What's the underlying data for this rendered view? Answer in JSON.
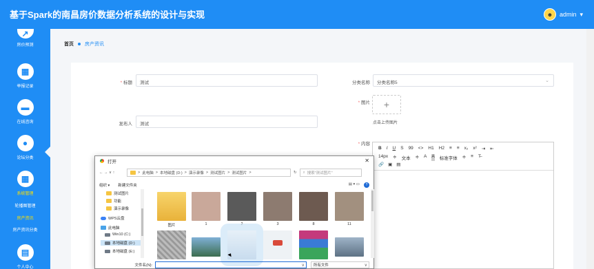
{
  "app": {
    "title": "基于Spark的南昌房价数据分析系统的设计与实现"
  },
  "user": {
    "name": "admin",
    "caret": "▾",
    "avatar_glyph": "☻"
  },
  "sidebar": {
    "items": [
      {
        "label": "房价预测",
        "icon": "trend-icon",
        "glyph": "↗"
      },
      {
        "label": "举报记录",
        "icon": "grid-icon",
        "glyph": "▦"
      },
      {
        "label": "在线咨询",
        "icon": "briefcase-icon",
        "glyph": "▬"
      },
      {
        "label": "论坛分类",
        "icon": "bulb-icon",
        "glyph": "●"
      },
      {
        "label": "系统管理",
        "icon": "apps-icon",
        "glyph": "▦"
      },
      {
        "label": "个人中心",
        "icon": "card-icon",
        "glyph": "▤"
      }
    ],
    "subitems": [
      {
        "label": "轮播图管理",
        "active": false
      },
      {
        "label": "房产资讯",
        "active": true
      },
      {
        "label": "房产资讯分类",
        "active": false
      }
    ]
  },
  "breadcrumb": {
    "home": "首页",
    "current": "房产资讯"
  },
  "form": {
    "title_label": "标题",
    "title_value": "测试",
    "category_label": "分类名称",
    "category_value": "分类名称5",
    "image_label": "图片",
    "upload_hint": "点击上传图片",
    "upload_plus": "+",
    "publisher_label": "发布人",
    "publisher_value": "测试",
    "content_label": "内容",
    "required_mark": "*"
  },
  "editor": {
    "toolbar_row1": [
      "B",
      "I",
      "U",
      "S",
      "99",
      "<>",
      "H1",
      "H2",
      "≡",
      "≡",
      "x₂",
      "x²",
      "⇥",
      "⇤"
    ],
    "toolbar_row2": [
      "14px",
      "≑",
      "文本",
      "≑",
      "A",
      "A",
      "标准字体",
      "≑",
      "≡",
      "T̶"
    ],
    "toolbar_row3": [
      "🔗",
      "▣",
      "▤"
    ]
  },
  "file_dialog": {
    "title": "打开",
    "close": "✕",
    "nav_arrows": "← → ∨ ↑",
    "path": [
      "此电脑",
      "本地磁盘 (D:)",
      "演示录像",
      "测试图片",
      "测试图片"
    ],
    "path_sep": ">",
    "refresh": "↻",
    "search_placeholder": "搜索\"测试图片\"",
    "organize": "组织 ▾",
    "new_folder": "新建文件夹",
    "view_options": "▤ ▾  ▭",
    "help": "?",
    "nav_items": [
      {
        "label": "测试图片",
        "icon": "folder-icon",
        "selected": false
      },
      {
        "label": "功能",
        "icon": "folder-icon",
        "selected": false
      },
      {
        "label": "演示录像",
        "icon": "folder-icon",
        "selected": false
      },
      {
        "label": "WPS云盘",
        "icon": "cloud-icon",
        "selected": false
      },
      {
        "label": "此电脑",
        "icon": "pc-icon",
        "selected": false
      },
      {
        "label": "Win10 (C:)",
        "icon": "drive-icon",
        "selected": false
      },
      {
        "label": "本地磁盘 (D:)",
        "icon": "drive-icon",
        "selected": true
      },
      {
        "label": "本地磁盘 (E:)",
        "icon": "drive-icon",
        "selected": false
      }
    ],
    "files": [
      {
        "label": "图片",
        "kind": "folder",
        "color": "#f3c453"
      },
      {
        "label": "1",
        "kind": "photo",
        "color": "#c9a89a"
      },
      {
        "label": "2",
        "kind": "photo",
        "color": "#5a5a5a"
      },
      {
        "label": "3",
        "kind": "photo",
        "color": "#8d7b70"
      },
      {
        "label": "8",
        "kind": "photo",
        "color": "#6d5a50"
      },
      {
        "label": "11",
        "kind": "photo",
        "color": "#a2907f"
      },
      {
        "label": "",
        "kind": "photo",
        "color": "#b7b7b7"
      },
      {
        "label": "",
        "kind": "photo",
        "color": "#7fb0d6"
      },
      {
        "label": "",
        "kind": "photo",
        "color": "#dbe9f4",
        "selected": true
      },
      {
        "label": "",
        "kind": "photo",
        "color": "#e9eef3"
      },
      {
        "label": "",
        "kind": "winrar",
        "color": "#3a7bd5"
      },
      {
        "label": "",
        "kind": "photo",
        "color": "#9fb4c8"
      }
    ],
    "filename_label": "文件名(N):",
    "filename_value": "",
    "filetype": "所有文件",
    "dropdown_chev": "∨"
  },
  "colors": {
    "primary": "#1f8df5",
    "active_sub": "#ffe000",
    "required": "#f56c6c"
  }
}
